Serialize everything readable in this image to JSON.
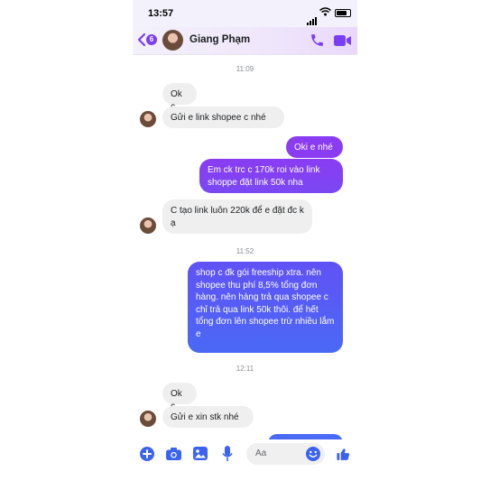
{
  "status_bar": {
    "time": "13:57"
  },
  "header": {
    "back_count": "6",
    "contact_name": "Giang Phạm"
  },
  "icons": {
    "back": "chevron-left-icon",
    "call": "phone-icon",
    "video": "video-camera-icon",
    "plus": "plus-circle-icon",
    "camera": "camera-icon",
    "gallery": "image-icon",
    "mic": "microphone-icon",
    "emoji": "smiley-icon",
    "like": "thumbs-up-icon"
  },
  "colors": {
    "accent": "#7b3ff2",
    "outgoing_top": "#8a3cf2",
    "outgoing_bottom": "#3f6ff5",
    "incoming": "#efefef"
  },
  "messages": {
    "t1": "11:09",
    "m1": "Ok c",
    "m2": "Gửi e link shopee c nhé",
    "m3": "Oki e nhé",
    "m4": "Em ck trc c 170k roi vào link shoppe đặt link 50k nha",
    "m5": "C tạo link luôn 220k để e đặt đc k ạ",
    "t2": "11:52",
    "m6": "shop c đk gói freeship xtra. nên shopee thu phí 8,5% tổng đơn hàng. nên hàng trả qua shopee c chỉ trả qua link 50k thôi. để hết tổng đơn lên shopee trừ nhiều lắm e",
    "t3": "12:11",
    "m7": "Ok c",
    "m8": "Gửi e xin stk nhé"
  },
  "composer": {
    "placeholder": "Aa"
  }
}
